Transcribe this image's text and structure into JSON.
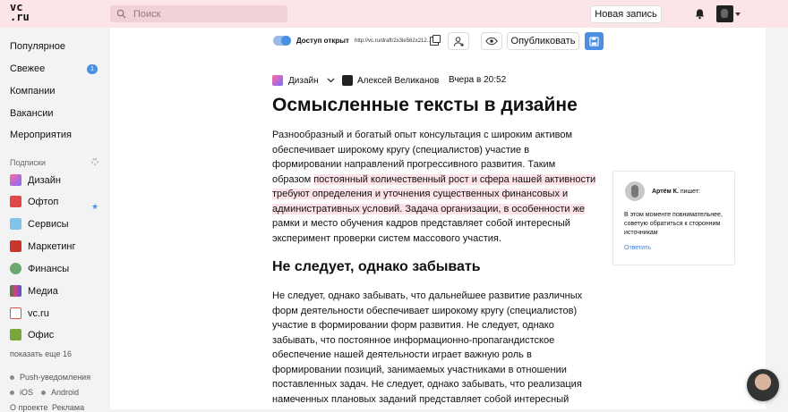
{
  "header": {
    "logo_line1": "vc",
    "logo_line2": ".ru",
    "search_placeholder": "Поиск",
    "new_post_label": "Новая запись"
  },
  "sidebar": {
    "items": [
      {
        "label": "Популярное"
      },
      {
        "label": "Свежее",
        "badge": "1"
      },
      {
        "label": "Компании"
      },
      {
        "label": "Вакансии"
      },
      {
        "label": "Мероприятия"
      }
    ],
    "subscriptions_label": "Подписки",
    "subscriptions": [
      {
        "label": "Дизайн",
        "color": "#d86aa8"
      },
      {
        "label": "Офтоп",
        "color": "#e04848"
      },
      {
        "label": "Сервисы",
        "color": "#7fc4e8"
      },
      {
        "label": "Маркетинг",
        "color": "#c8372d"
      },
      {
        "label": "Финансы",
        "color": "#6fa86f"
      },
      {
        "label": "Медиа",
        "color": "#3a8a3a"
      },
      {
        "label": "vc.ru",
        "color": "#e05050"
      },
      {
        "label": "Офис",
        "color": "#7aa63a"
      }
    ],
    "show_more": "показать еще 16",
    "push": "Push-уведомления",
    "ios": "iOS",
    "android": "Android",
    "about": "О проекте",
    "ads": "Реклама"
  },
  "editor": {
    "access_label": "Доступ открыт",
    "url": "http://vc.ru/draft/2x3ie562x212...",
    "publish_label": "Опубликовать"
  },
  "article": {
    "rubric": "Дизайн",
    "author": "Алексей Великанов",
    "date": "Вчера в 20:52",
    "title": "Осмысленные тексты в дизайне",
    "p1_a": "Разнообразный и богатый опыт консультация с широким активом обеспечивает широкому кругу (специалистов) участие в формировании направлений прогрессивного развития. Таким образом ",
    "p1_hl": "постоянный количественный рост и сфера нашей активности требуют определения и уточнения существенных финансовых и административных условий. Задача организации, в особенности же",
    "p1_b": " рамки и место обучения кадров представляет собой интересный эксперимент проверки систем массового участия.",
    "subtitle": "Не следует, однако забывать",
    "p2": "Не следует, однако забывать, что дальнейшее развитие различных форм деятельности обеспечивает широкому кругу (специалистов) участие в формировании форм развития. Не следует, однако забывать, что постоянное информационно-пропагандистское обеспечение нашей деятельности играет важную роль в формировании позиций, занимаемых участниками в отношении поставленных задач. Не следует, однако забывать, что реализация намеченных плановых заданий представляет собой интересный"
  },
  "comment": {
    "author": "Артём К.",
    "writes": " пишет:",
    "text": "В этом моменте повнимательнее, советую обратиться к сторонним источникам",
    "reply": "Ответить"
  },
  "colors": {
    "header_bg": "#fbe5e8",
    "accent": "#4a90e2",
    "highlight": "#fde3e8"
  }
}
